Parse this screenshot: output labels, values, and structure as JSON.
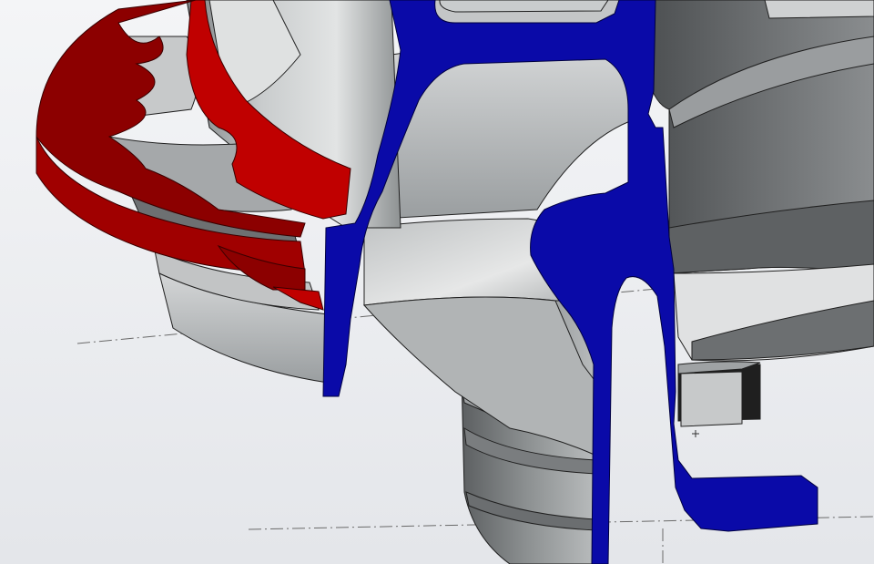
{
  "viewport": {
    "background_top": "#f4f5f7",
    "background_bottom": "#e4e6ea"
  },
  "colors": {
    "section_cut_primary": "#0a0aa8",
    "section_cut_secondary": "#c00000",
    "section_cut_secondary_dark": "#8c0000",
    "body_light": "#c9cccd",
    "body_mid": "#9ea2a3",
    "body_dark": "#5b5e60",
    "body_shadow": "#3d3f41",
    "edge": "#202020",
    "centerline": "#6a6a6a"
  },
  "icons": [
    "origin-marker-icon"
  ]
}
